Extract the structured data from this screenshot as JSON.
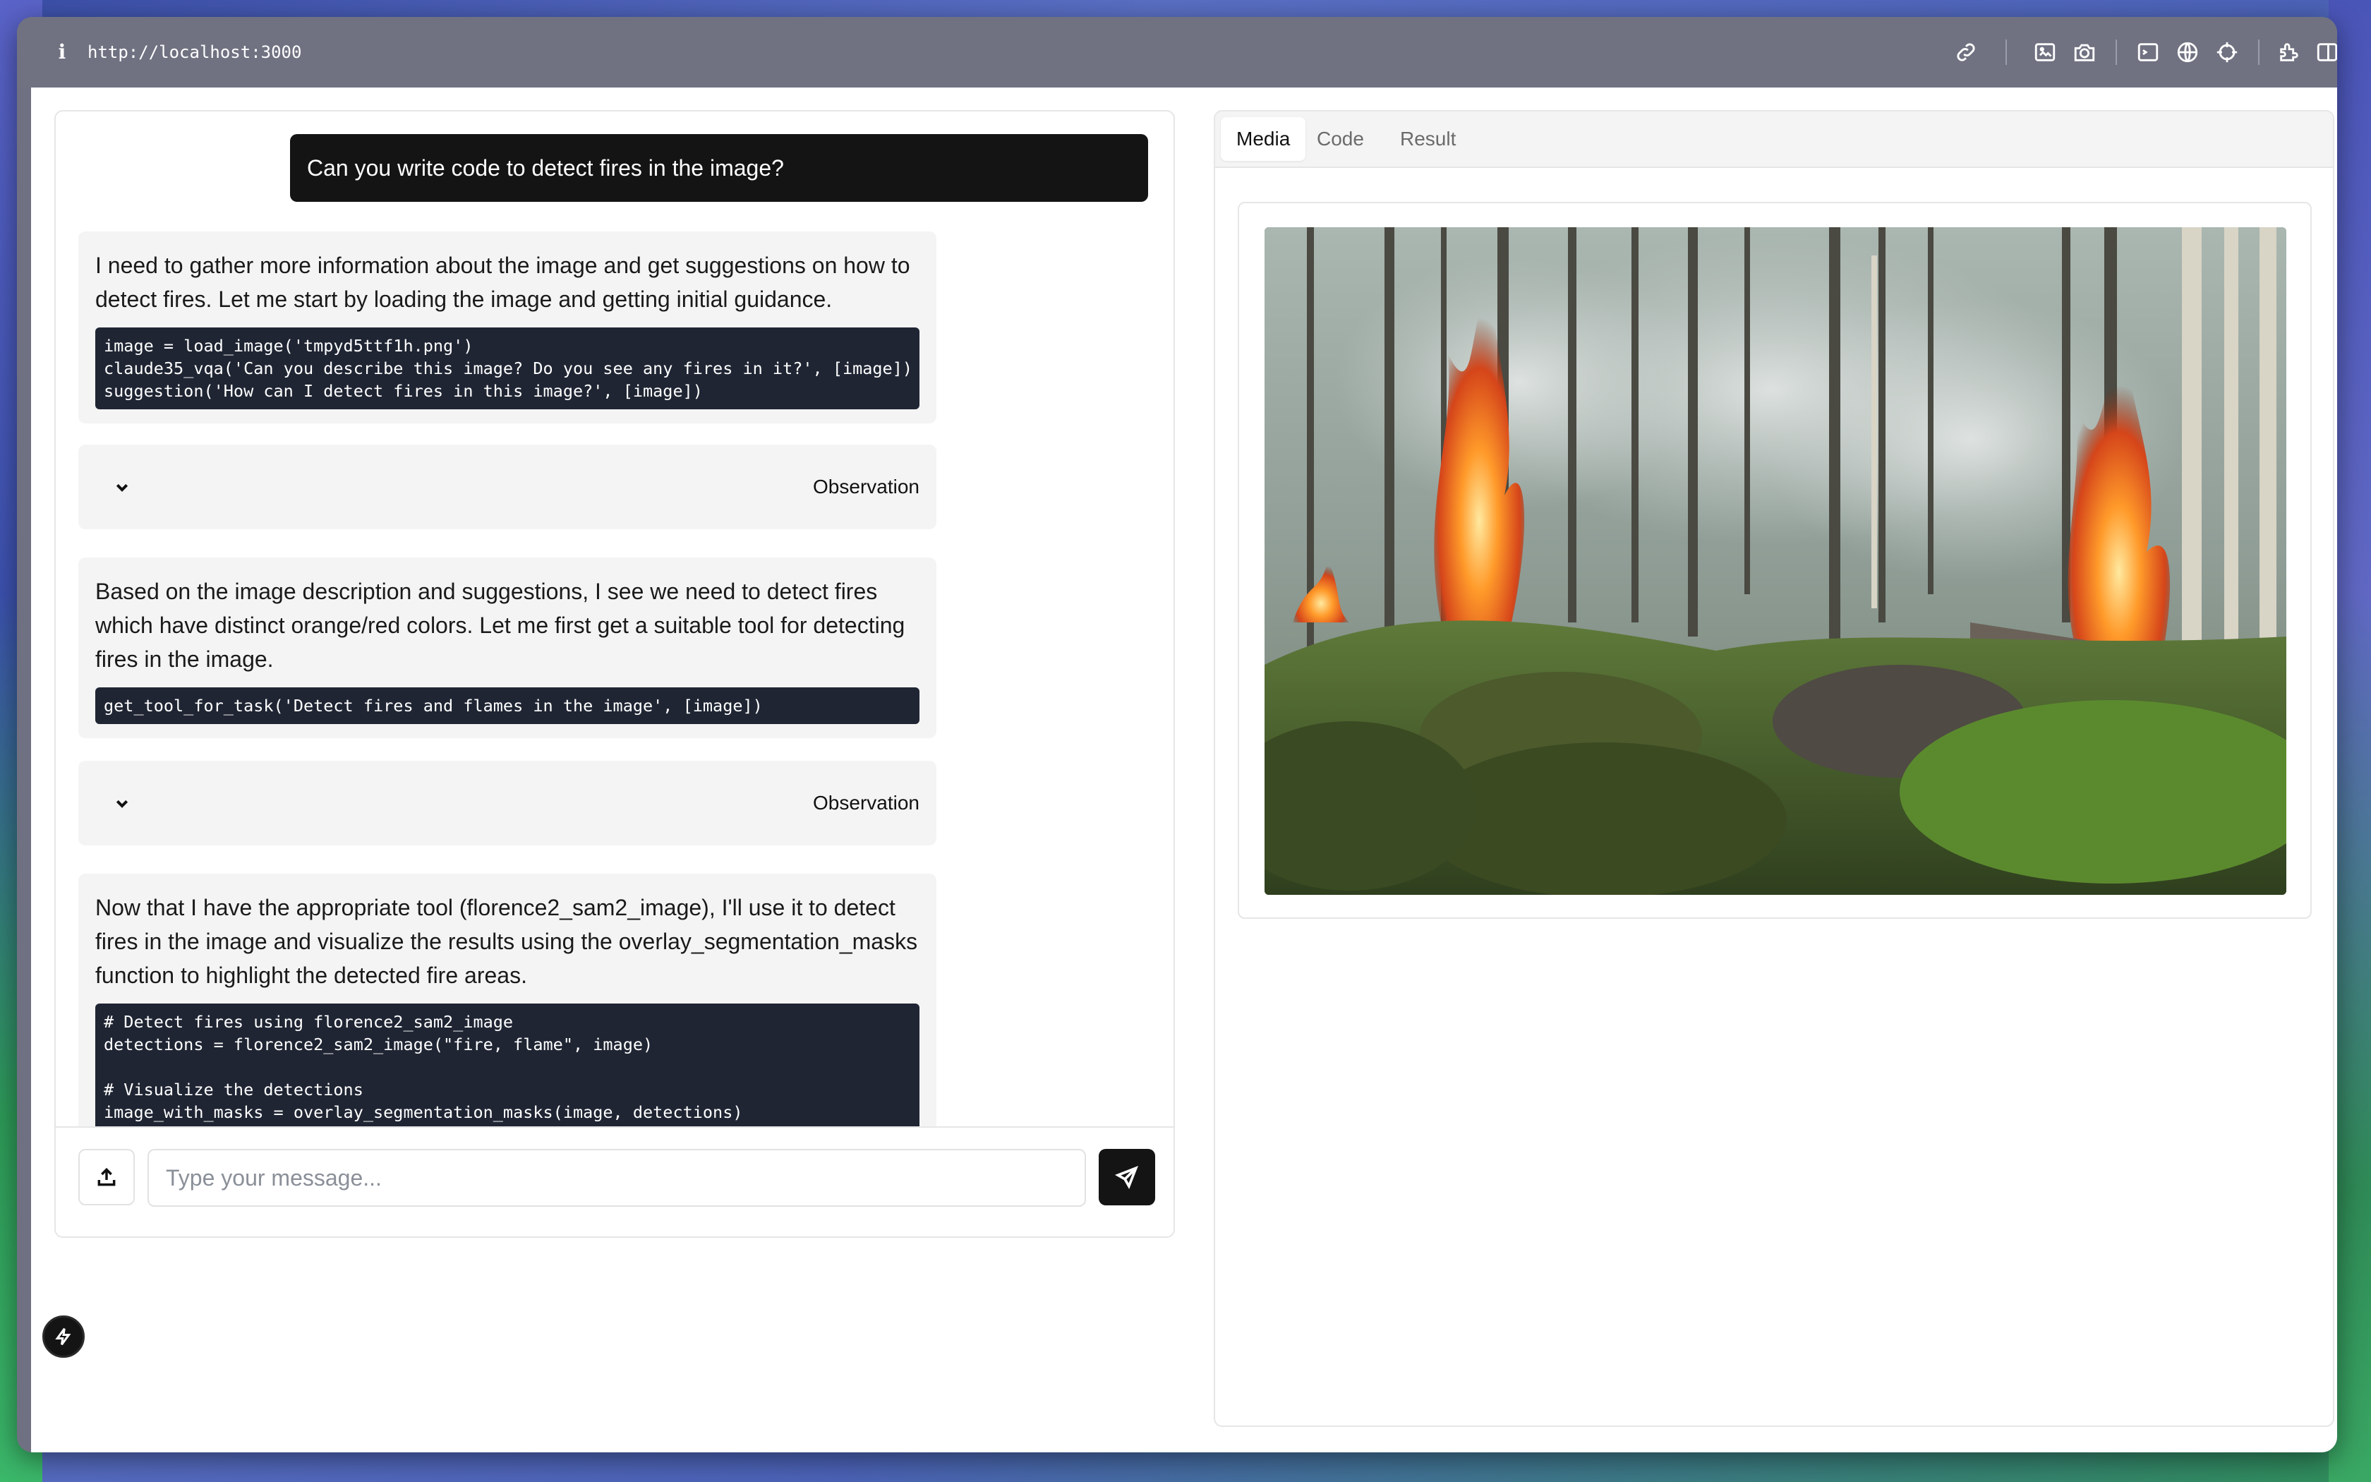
{
  "browser": {
    "url": "http://localhost:3000",
    "info_icon": "i",
    "toolbar_icons": [
      "link-icon",
      "image-icon",
      "camera-icon",
      "terminal-icon",
      "globe-icon",
      "crosshair-icon",
      "extension-icon",
      "split-view-icon"
    ]
  },
  "chat": {
    "user_message": "Can you write code to detect fires in the image?",
    "messages": [
      {
        "text": "I need to gather more information about the image and get suggestions on how to detect fires. Let me start by loading the image and getting initial guidance.",
        "code": "image = load_image('tmpyd5ttf1h.png')\nclaude35_vqa('Can you describe this image? Do you see any fires in it?', [image])\nsuggestion('How can I detect fires in this image?', [image])"
      },
      {
        "text": "Based on the image description and suggestions, I see we need to detect fires which have distinct orange/red colors. Let me first get a suitable tool for detecting fires in the image.",
        "code": "get_tool_for_task('Detect fires and flames in the image', [image])"
      },
      {
        "text": "Now that I have the appropriate tool (florence2_sam2_image), I'll use it to detect fires in the image and visualize the results using the overlay_segmentation_masks function to highlight the detected fire areas.",
        "code": "# Detect fires using florence2_sam2_image\ndetections = florence2_sam2_image(\"fire, flame\", image)\n\n# Visualize the detections\nimage_with_masks = overlay_segmentation_masks(image, detections)"
      }
    ],
    "observation_label": "Observation",
    "input_placeholder": "Type your message..."
  },
  "right_panel": {
    "tabs": [
      "Media",
      "Code",
      "Result"
    ],
    "active_tab": "Media"
  },
  "colors": {
    "dark": "#141414",
    "code_bg": "#1f2533",
    "bubble_bg": "#f4f4f4"
  }
}
